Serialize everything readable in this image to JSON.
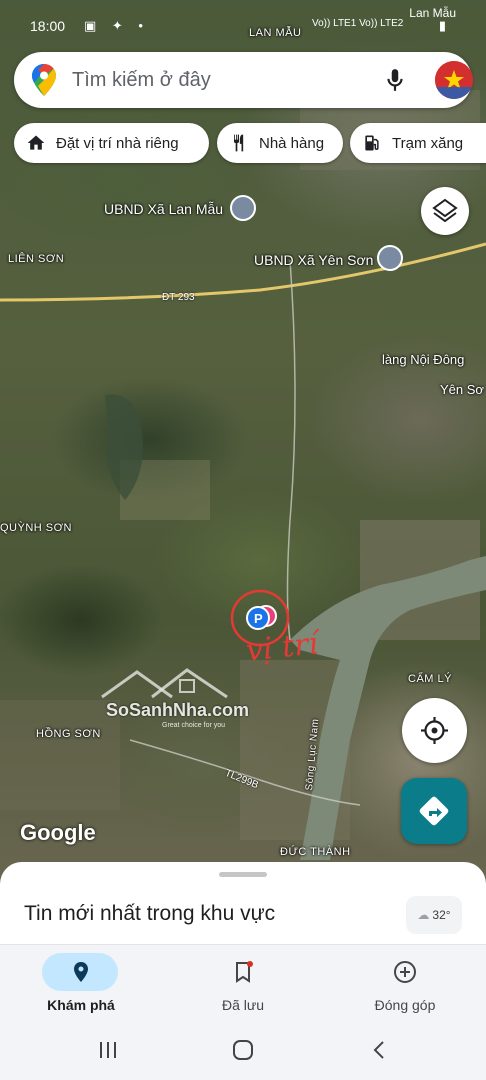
{
  "status_bar": {
    "time": "18:00",
    "carrier": "Lan Mẫu",
    "network_1": "Vo)) LTE1",
    "network_2": "Vo)) LTE2",
    "battery_icon": "battery-icon"
  },
  "search": {
    "placeholder": "Tìm kiếm ở đây",
    "mic_icon": "mic-icon",
    "avatar_icon": "avatar-icon"
  },
  "chips": [
    {
      "label": "Đặt vị trí nhà riêng",
      "icon": "home-icon"
    },
    {
      "label": "Nhà hàng",
      "icon": "restaurant-icon"
    },
    {
      "label": "Trạm xăng",
      "icon": "gas-station-icon"
    }
  ],
  "map": {
    "labels": {
      "lan_mau": "LAN MẪU",
      "ubnd_lan_mau": "UBND Xã Lan Mẫu",
      "lien_son": "LIÊN SƠN",
      "ubnd_yen_son": "UBND Xã Yên Sơn",
      "road_293": "ĐT 293",
      "lang_noi_dong": "làng Nội Đông",
      "yen_son": "Yên Sơ",
      "quynh_son": "QUỲNH SƠN",
      "cam_ly": "CẨM LÝ",
      "hong_son": "HỒNG SƠN",
      "road_299b": "TL299B",
      "song_luc_nam": "Sông Lục Nam",
      "duc_thanh": "ĐỨC THÀNH",
      "handwritten": "vị trí"
    },
    "watermark": {
      "brand": "SoSanhNha.com",
      "tagline": "Great choice for you"
    },
    "attribution": "Google",
    "accent_colors": {
      "river": "#7e8a78",
      "pin": "#1a73e8",
      "pin_alt": "#e8407a",
      "annotation": "#e53935"
    }
  },
  "buttons": {
    "layers_icon": "layers-icon",
    "locate_icon": "my-location-icon",
    "directions_icon": "directions-icon"
  },
  "sheet": {
    "title": "Tin mới nhất trong khu vực",
    "weather": "32°"
  },
  "nav": [
    {
      "label": "Khám phá",
      "icon": "explore-pin-icon",
      "active": true
    },
    {
      "label": "Đã lưu",
      "icon": "bookmark-icon",
      "active": false
    },
    {
      "label": "Đóng góp",
      "icon": "add-circle-icon",
      "active": false
    }
  ],
  "system_nav": [
    "recents-icon",
    "home-icon",
    "back-icon"
  ]
}
